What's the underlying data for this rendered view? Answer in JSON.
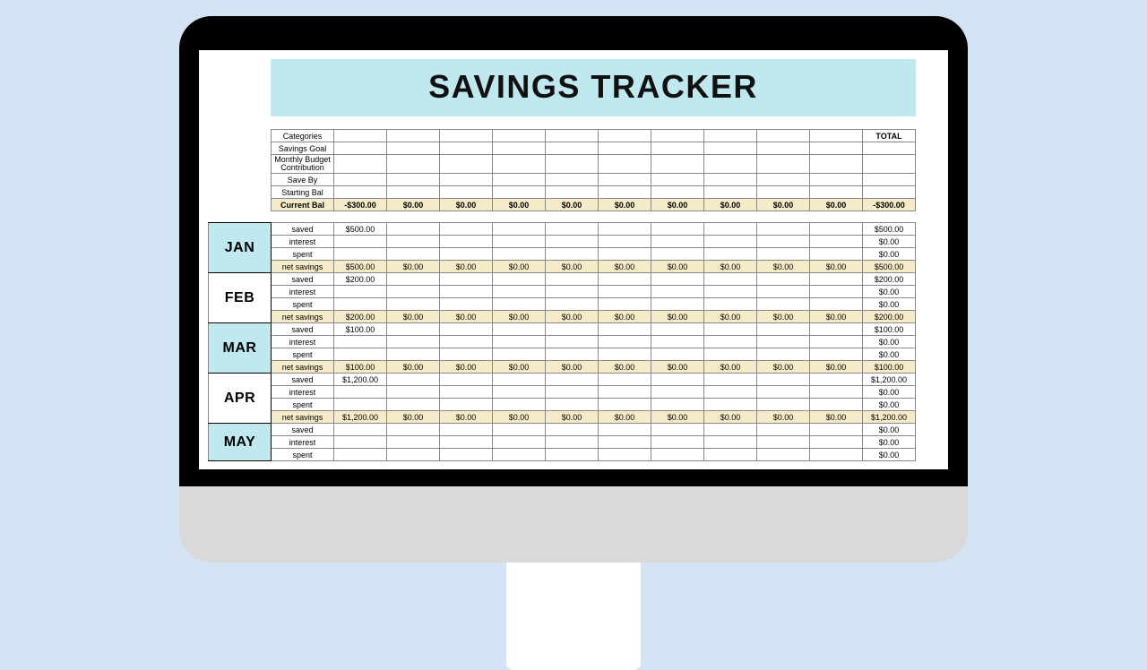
{
  "title": "SAVINGS TRACKER",
  "summary": {
    "labels": [
      "Categories",
      "Savings Goal",
      "Monthly Budget\nContribution",
      "Save By",
      "Starting Bal",
      "Current Bal"
    ],
    "total_label": "TOTAL",
    "current_row": [
      "-$300.00",
      "$0.00",
      "$0.00",
      "$0.00",
      "$0.00",
      "$0.00",
      "$0.00",
      "$0.00",
      "$0.00",
      "$0.00"
    ],
    "current_total": "-$300.00"
  },
  "months": [
    {
      "name": "JAN",
      "highlight": true,
      "rows": [
        {
          "label": "saved",
          "cells": [
            "$500.00",
            "",
            "",
            "",
            "",
            "",
            "",
            "",
            "",
            ""
          ],
          "total": "$500.00"
        },
        {
          "label": "interest",
          "cells": [
            "",
            "",
            "",
            "",
            "",
            "",
            "",
            "",
            "",
            ""
          ],
          "total": "$0.00"
        },
        {
          "label": "spent",
          "cells": [
            "",
            "",
            "",
            "",
            "",
            "",
            "",
            "",
            "",
            ""
          ],
          "total": "$0.00"
        },
        {
          "label": "net savings",
          "cells": [
            "$500.00",
            "$0.00",
            "$0.00",
            "$0.00",
            "$0.00",
            "$0.00",
            "$0.00",
            "$0.00",
            "$0.00",
            "$0.00"
          ],
          "total": "$500.00",
          "net": true
        }
      ]
    },
    {
      "name": "FEB",
      "highlight": false,
      "rows": [
        {
          "label": "saved",
          "cells": [
            "$200.00",
            "",
            "",
            "",
            "",
            "",
            "",
            "",
            "",
            ""
          ],
          "total": "$200.00"
        },
        {
          "label": "interest",
          "cells": [
            "",
            "",
            "",
            "",
            "",
            "",
            "",
            "",
            "",
            ""
          ],
          "total": "$0.00"
        },
        {
          "label": "spent",
          "cells": [
            "",
            "",
            "",
            "",
            "",
            "",
            "",
            "",
            "",
            ""
          ],
          "total": "$0.00"
        },
        {
          "label": "net savings",
          "cells": [
            "$200.00",
            "$0.00",
            "$0.00",
            "$0.00",
            "$0.00",
            "$0.00",
            "$0.00",
            "$0.00",
            "$0.00",
            "$0.00"
          ],
          "total": "$200.00",
          "net": true
        }
      ]
    },
    {
      "name": "MAR",
      "highlight": true,
      "rows": [
        {
          "label": "saved",
          "cells": [
            "$100.00",
            "",
            "",
            "",
            "",
            "",
            "",
            "",
            "",
            ""
          ],
          "total": "$100.00"
        },
        {
          "label": "interest",
          "cells": [
            "",
            "",
            "",
            "",
            "",
            "",
            "",
            "",
            "",
            ""
          ],
          "total": "$0.00"
        },
        {
          "label": "spent",
          "cells": [
            "",
            "",
            "",
            "",
            "",
            "",
            "",
            "",
            "",
            ""
          ],
          "total": "$0.00"
        },
        {
          "label": "net savings",
          "cells": [
            "$100.00",
            "$0.00",
            "$0.00",
            "$0.00",
            "$0.00",
            "$0.00",
            "$0.00",
            "$0.00",
            "$0.00",
            "$0.00"
          ],
          "total": "$100.00",
          "net": true
        }
      ]
    },
    {
      "name": "APR",
      "highlight": false,
      "rows": [
        {
          "label": "saved",
          "cells": [
            "$1,200.00",
            "",
            "",
            "",
            "",
            "",
            "",
            "",
            "",
            ""
          ],
          "total": "$1,200.00"
        },
        {
          "label": "interest",
          "cells": [
            "",
            "",
            "",
            "",
            "",
            "",
            "",
            "",
            "",
            ""
          ],
          "total": "$0.00"
        },
        {
          "label": "spent",
          "cells": [
            "",
            "",
            "",
            "",
            "",
            "",
            "",
            "",
            "",
            ""
          ],
          "total": "$0.00"
        },
        {
          "label": "net savings",
          "cells": [
            "$1,200.00",
            "$0.00",
            "$0.00",
            "$0.00",
            "$0.00",
            "$0.00",
            "$0.00",
            "$0.00",
            "$0.00",
            "$0.00"
          ],
          "total": "$1,200.00",
          "net": true
        }
      ]
    },
    {
      "name": "MAY",
      "highlight": true,
      "rows": [
        {
          "label": "saved",
          "cells": [
            "",
            "",
            "",
            "",
            "",
            "",
            "",
            "",
            "",
            ""
          ],
          "total": "$0.00"
        },
        {
          "label": "interest",
          "cells": [
            "",
            "",
            "",
            "",
            "",
            "",
            "",
            "",
            "",
            ""
          ],
          "total": "$0.00"
        },
        {
          "label": "spent",
          "cells": [
            "",
            "",
            "",
            "",
            "",
            "",
            "",
            "",
            "",
            ""
          ],
          "total": "$0.00"
        }
      ]
    }
  ]
}
